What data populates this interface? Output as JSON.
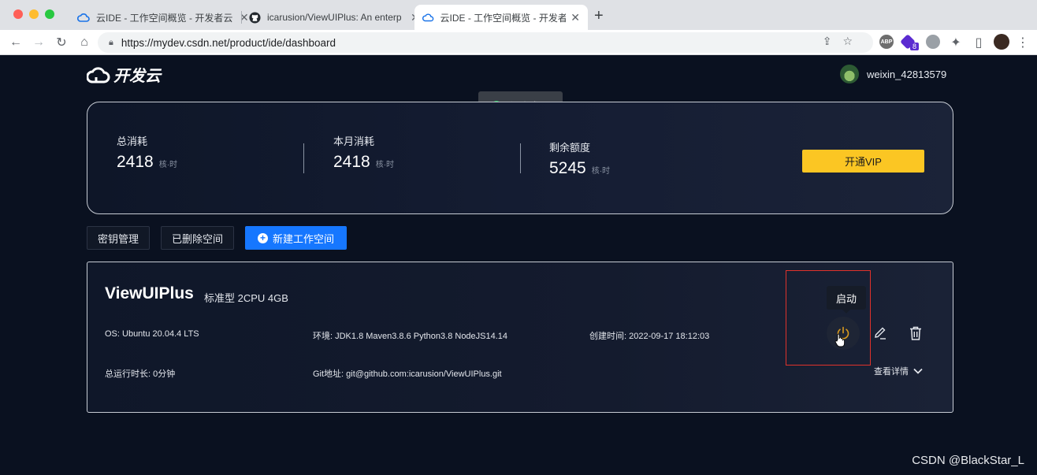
{
  "browser": {
    "tabs": [
      {
        "title": "云IDE - 工作空间概览 - 开发者云",
        "active": false,
        "icon": "cloud-icon"
      },
      {
        "title": "icarusion/ViewUIPlus: An enterp",
        "active": false,
        "icon": "github-icon"
      },
      {
        "title": "云IDE - 工作空间概览 - 开发者云",
        "active": true,
        "icon": "cloud-icon"
      }
    ],
    "url": "https://mydev.csdn.net/product/ide/dashboard",
    "extension_badge": "8",
    "abp_label": "ABP"
  },
  "header": {
    "logo_text": "开发云",
    "username": "weixin_42813579"
  },
  "toast": {
    "message": "创建成功"
  },
  "stats": {
    "total": {
      "label": "总消耗",
      "value": "2418",
      "unit": "核·时"
    },
    "month": {
      "label": "本月消耗",
      "value": "2418",
      "unit": "核·时"
    },
    "remaining": {
      "label": "剩余额度",
      "value": "5245",
      "unit": "核·时"
    },
    "vip_button": "开通VIP"
  },
  "actions": {
    "keys": "密钥管理",
    "deleted": "已删除空间",
    "new_workspace": "新建工作空间"
  },
  "workspace": {
    "name": "ViewUIPlus",
    "spec": "标准型 2CPU 4GB",
    "os": "OS: Ubuntu 20.04.4 LTS",
    "env": "环境: JDK1.8 Maven3.8.6 Python3.8 NodeJS14.14",
    "created": "创建时间: 2022-09-17 18:12:03",
    "runtime": "总运行时长: 0分钟",
    "git": "Git地址: git@github.com:icarusion/ViewUIPlus.git",
    "start_tooltip": "启动",
    "details_label": "查看详情"
  },
  "watermark": "CSDN @BlackStar_L",
  "colors": {
    "accent": "#1677ff",
    "vip": "#fbc623",
    "success": "#22c55e",
    "highlight": "#e0322b",
    "power_icon": "#d99a1e"
  }
}
